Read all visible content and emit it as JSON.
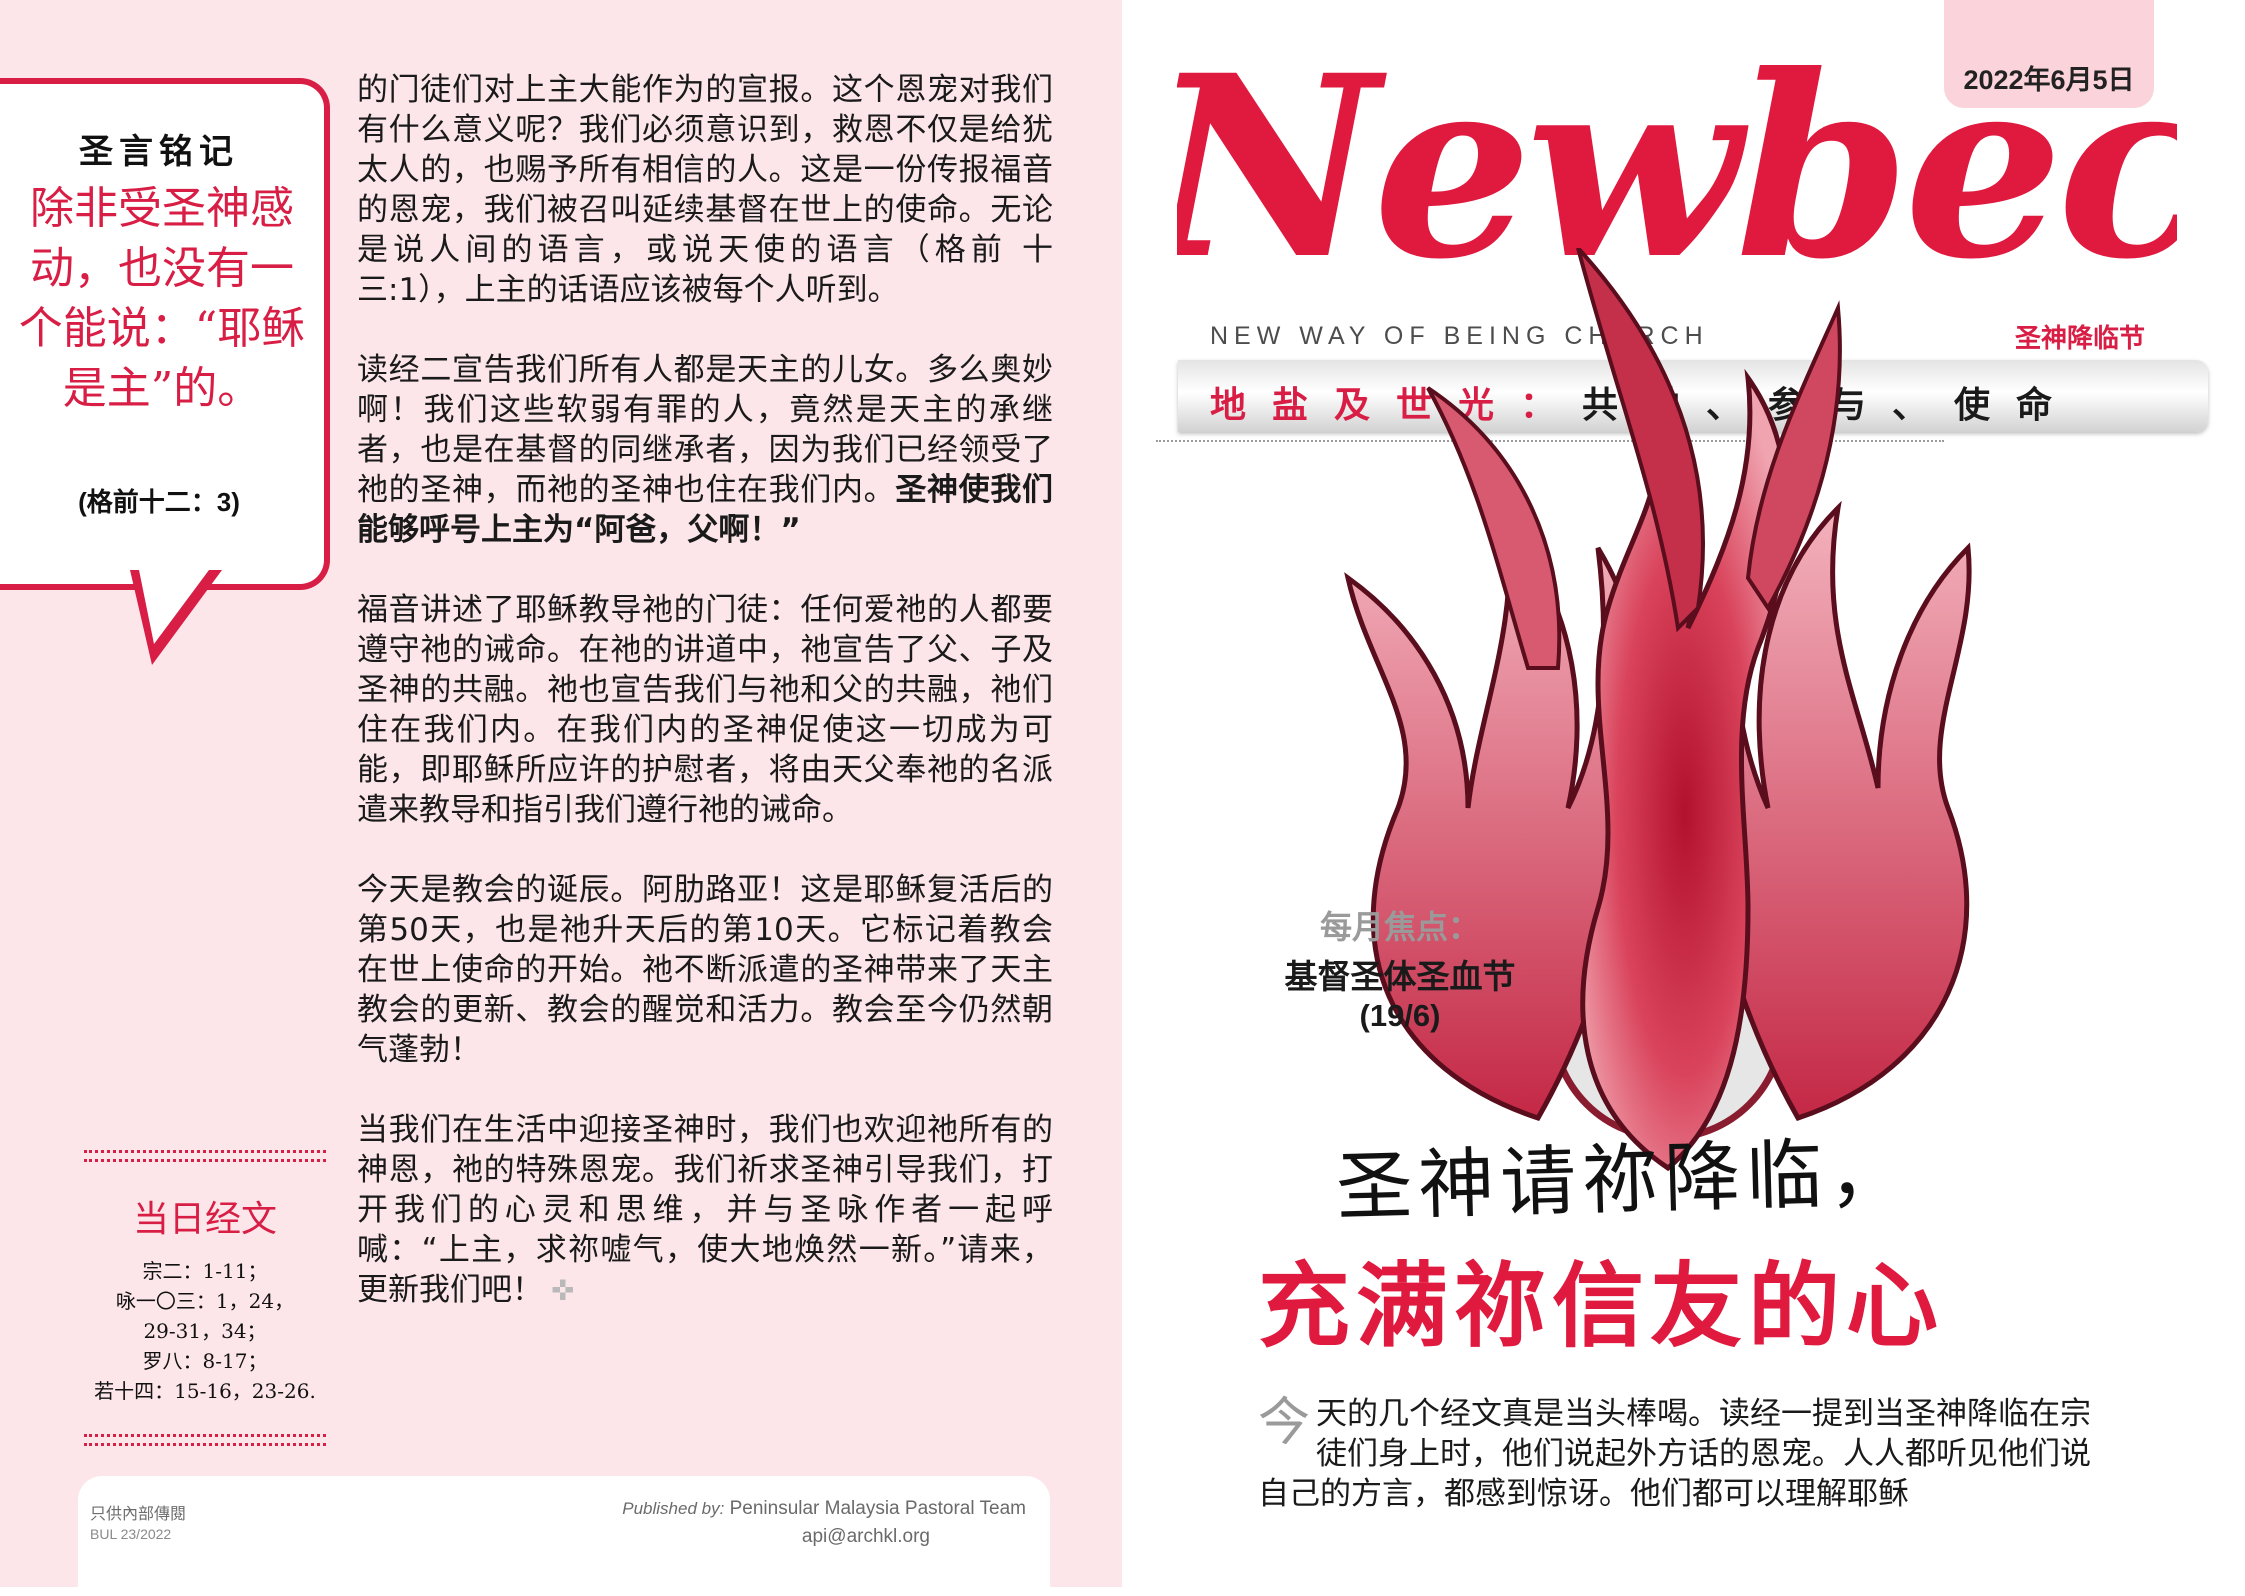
{
  "verse_box": {
    "title": "圣言铭记",
    "text": "除非受圣神感动，也没有一个能说：“耶稣是主”的。",
    "reference": "(格前十二：3)"
  },
  "readings": {
    "title": "当日经文",
    "items": [
      "宗二：1-11；",
      "咏一〇三：1，24，",
      "29-31，34；",
      "罗八：8-17；",
      "若十四：15-16，23-26."
    ]
  },
  "article": {
    "p1": "的门徒们对上主大能作为的宣报。这个恩宠对我们有什么意义呢？我们必须意识到，救恩不仅是给犹太人的，也赐予所有相信的人。这是一份传报福音的恩宠，我们被召叫延续基督在世上的使命。无论是说人间的语言，或说天使的语言（格前 十三:1），上主的话语应该被每个人听到。",
    "p2": "读经二宣告我们所有人都是天主的儿女。多么奥妙啊！我们这些软弱有罪的人，竟然是天主的承继者，也是在基督的同继承者，因为我们已经领受了祂的圣神，而祂的圣神也住在我们内。",
    "p2_bold": "圣神使我们能够呼号上主为“阿爸，父啊！”",
    "p3": "福音讲述了耶稣教导祂的门徒：任何爱祂的人都要遵守祂的诫命。在祂的讲道中，祂宣告了父、子及圣神的共融。祂也宣告我们与祂和父的共融，祂们住在我们内。在我们内的圣神促使这一切成为可能，即耶稣所应许的护慰者，将由天父奉祂的名派遣来教导和指引我们遵行祂的诫命。",
    "p4": "今天是教会的诞辰。阿肋路亚！这是耶稣复活后的第50天，也是祂升天后的第10天。它标记着教会在世上使命的开始。祂不断派遣的圣神带来了天主教会的更新、教会的醒觉和活力。教会至今仍然朝气蓬勃！",
    "p5": "当我们在生活中迎接圣神时，我们也欢迎祂所有的神恩，祂的特殊恩宠。我们祈求圣神引导我们，打开我们的心灵和思维，并与圣咏作者一起呼喊：“上主，求祢嘘气，使大地焕然一新。”请来，更新我们吧！",
    "end_mark": "✜"
  },
  "footer": {
    "internal": "只供內部傳閱",
    "bulletin": "BUL 23/2022",
    "published_by_label": "Published by:",
    "publisher": "Peninsular Malaysia Pastoral Team",
    "email": "api@archkl.org"
  },
  "masthead": {
    "date": "2022年6月5日",
    "logo": "Newbec",
    "tagline": "NEW WAY OF BEING CHURCH",
    "feast": "圣神降临节",
    "theme_red": "地盐及世光：",
    "theme_dark": "共融、参与、使命"
  },
  "monthly_focus": {
    "label": "每月焦点：",
    "event": "基督圣体圣血节",
    "date": "(19/6)"
  },
  "headline": {
    "line1": "圣神请祢降临，",
    "line2": "充满祢信友的心"
  },
  "intro": {
    "dropcap": "今",
    "text": "天的几个经文真是当头棒喝。读经一提到当圣神降临在宗徒们身上时，他们说起外方话的恩宠。人人都听见他们说自己的方言，都感到惊讶。他们都可以理解耶稣"
  },
  "colors": {
    "brand_red": "#d81e45",
    "page_pink": "#fce6ea",
    "date_tab_pink": "#fbd4db"
  }
}
